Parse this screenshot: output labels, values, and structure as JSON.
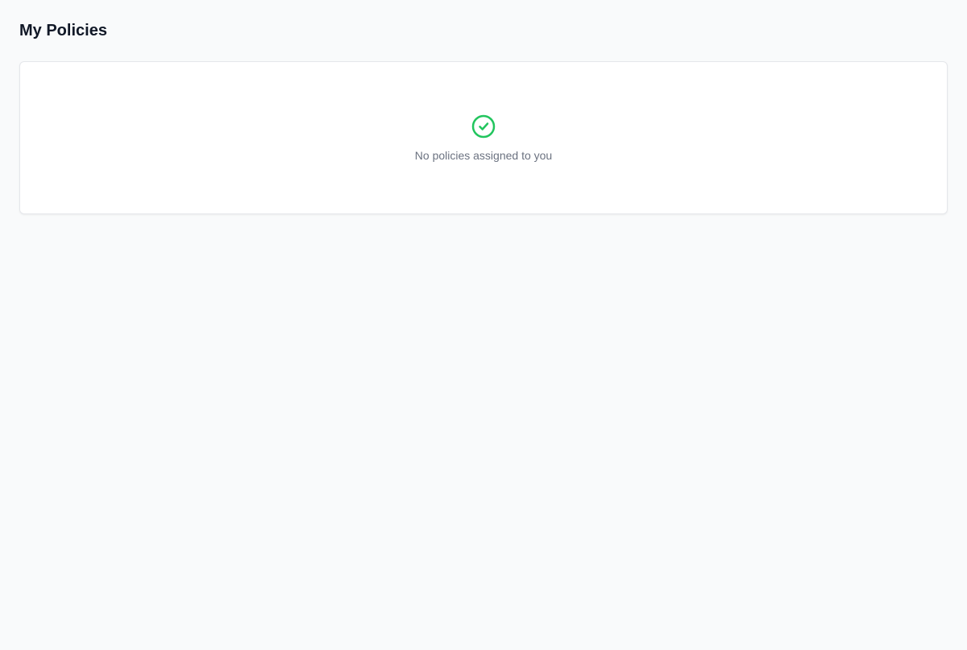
{
  "page": {
    "title": "My Policies"
  },
  "empty_state": {
    "message": "No policies assigned to you",
    "icon": "check-circle-icon"
  },
  "colors": {
    "background": "#f9fafb",
    "card": "#ffffff",
    "border": "#e5e7eb",
    "title": "#111827",
    "muted_text": "#6b7280",
    "success": "#22c55e"
  }
}
